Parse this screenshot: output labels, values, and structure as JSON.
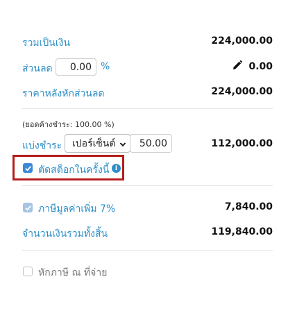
{
  "summary": {
    "total_label": "รวมเป็นเงิน",
    "total_value": "224,000.00",
    "discount_label": "ส่วนลด",
    "discount_input": "0.00",
    "discount_unit": "%",
    "discount_value": "0.00",
    "after_discount_label": "ราคาหลังหักส่วนลด",
    "after_discount_value": "224,000.00"
  },
  "installment": {
    "remaining_note": "(ยอดค้างชำระ: 100.00 %)",
    "label": "แบ่งชำระ",
    "select_value": "เปอร์เซ็นต์",
    "amount_input": "50.00",
    "value": "112,000.00"
  },
  "stock": {
    "checked": true,
    "label": "ตัดสต็อกในครั้งนี้"
  },
  "vat": {
    "label": "ภาษีมูลค่าเพิ่ม 7%",
    "value": "7,840.00",
    "checked": true
  },
  "grand_total": {
    "label": "จำนวนเงินรวมทั้งสิ้น",
    "value": "119,840.00"
  },
  "withholding": {
    "label": "หักภาษี ณ ที่จ่าย",
    "checked": false
  },
  "colors": {
    "label_blue": "#2d8fc8",
    "checkbox_blue": "#3b89d8",
    "highlight_red": "#b71c1c"
  },
  "icons": [
    "pencil-icon",
    "info-icon",
    "chevron-down-icon",
    "checkmark-icon"
  ]
}
